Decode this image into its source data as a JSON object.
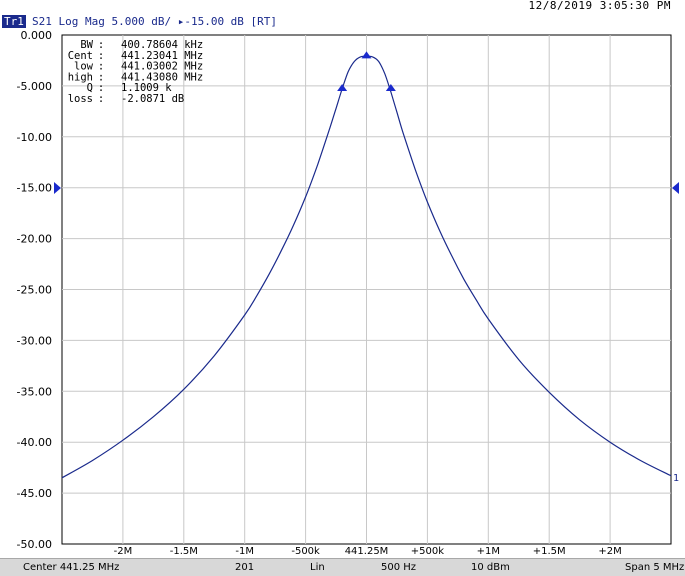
{
  "datetime": "12/8/2019 3:05:30 PM",
  "trace": {
    "tag": "Tr1",
    "params": "S21 Log Mag 5.000 dB/",
    "ref": "-15.00 dB [RT]",
    "end_label": "1"
  },
  "stats": [
    {
      "label": "BW",
      "value": "400.78604 kHz"
    },
    {
      "label": "Cent",
      "value": "441.23041 MHz"
    },
    {
      "label": "low",
      "value": "441.03002 MHz"
    },
    {
      "label": "high",
      "value": "441.43080 MHz"
    },
    {
      "label": "Q",
      "value": "1.1009 k"
    },
    {
      "label": "loss",
      "value": "-2.0871 dB"
    }
  ],
  "status": {
    "center": "Center 441.25 MHz",
    "points": "201",
    "sweep": "Lin",
    "ifbw": "500 Hz",
    "power": "10 dBm",
    "span": "Span 5 MHz"
  },
  "colors": {
    "trace": "#1a2a8c",
    "grid": "#c8c8c8",
    "marker": "#1a2acc"
  },
  "chart_data": {
    "type": "line",
    "xlim": [
      -2.5,
      2.5
    ],
    "ylim": [
      -50,
      0
    ],
    "x_ticks": [
      {
        "v": -2,
        "label": "-2M"
      },
      {
        "v": -1.5,
        "label": "-1.5M"
      },
      {
        "v": -1,
        "label": "-1M"
      },
      {
        "v": -0.5,
        "label": "-500k"
      },
      {
        "v": 0,
        "label": "441.25M"
      },
      {
        "v": 0.5,
        "label": "+500k"
      },
      {
        "v": 1,
        "label": "+1M"
      },
      {
        "v": 1.5,
        "label": "+1.5M"
      },
      {
        "v": 2,
        "label": "+2M"
      }
    ],
    "y_ticks": [
      "0.000",
      "-5.000",
      "-10.00",
      "-15.00",
      "-20.00",
      "-25.00",
      "-30.00",
      "-35.00",
      "-40.00",
      "-45.00",
      "-50.00"
    ],
    "grid": true,
    "series": [
      {
        "x": [
          -2.5,
          -2.25,
          -2.0,
          -1.75,
          -1.5,
          -1.25,
          -1.0,
          -0.9,
          -0.8,
          -0.7,
          -0.6,
          -0.5,
          -0.4,
          -0.3,
          -0.25,
          -0.2,
          -0.15,
          -0.1,
          -0.05,
          0.0,
          0.05,
          0.1,
          0.15,
          0.2,
          0.25,
          0.3,
          0.4,
          0.5,
          0.6,
          0.7,
          0.8,
          0.9,
          1.0,
          1.25,
          1.5,
          1.75,
          2.0,
          2.25,
          2.5
        ],
        "y": [
          -43.5,
          -41.8,
          -39.8,
          -37.5,
          -34.8,
          -31.5,
          -27.5,
          -25.6,
          -23.5,
          -21.2,
          -18.7,
          -15.9,
          -12.7,
          -9.1,
          -7.2,
          -5.3,
          -3.6,
          -2.6,
          -2.15,
          -2.1,
          -2.15,
          -2.6,
          -3.8,
          -5.6,
          -7.6,
          -9.6,
          -13.2,
          -16.4,
          -19.2,
          -21.7,
          -24.0,
          -26.0,
          -27.9,
          -31.9,
          -35.1,
          -37.8,
          -40.0,
          -41.8,
          -43.3
        ]
      }
    ],
    "markers": [
      {
        "x": -0.2,
        "y": -5.3
      },
      {
        "x": 0.0,
        "y": -2.1
      },
      {
        "x": 0.2,
        "y": -5.3
      }
    ]
  }
}
